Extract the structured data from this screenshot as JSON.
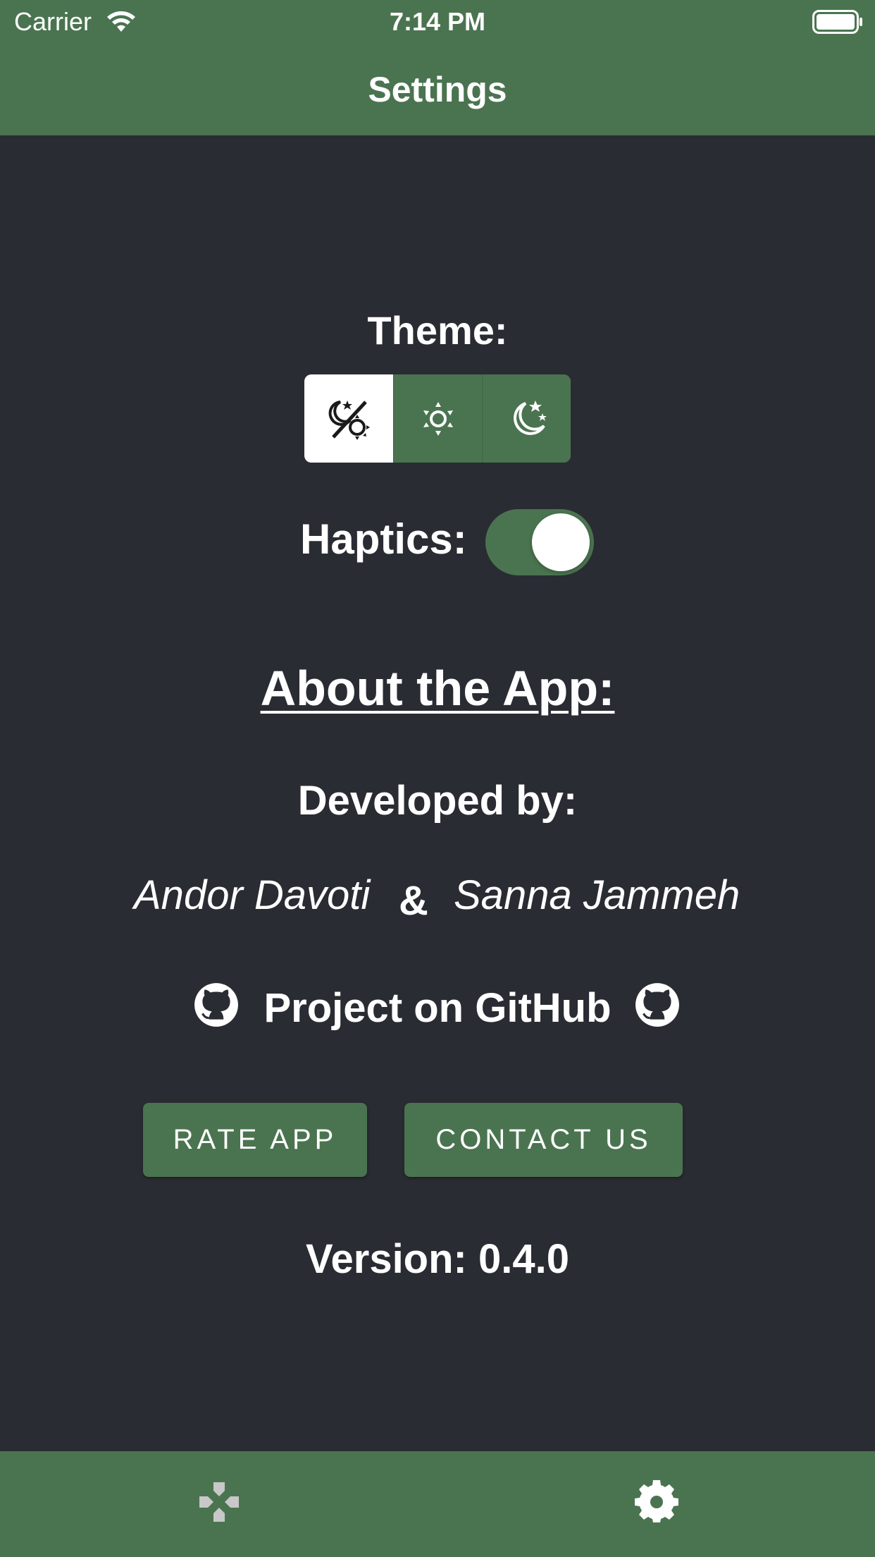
{
  "status_bar": {
    "carrier": "Carrier",
    "time": "7:14 PM"
  },
  "header": {
    "title": "Settings"
  },
  "theme": {
    "label": "Theme:",
    "options": [
      {
        "icon": "auto-theme-icon",
        "selected": true
      },
      {
        "icon": "light-theme-sun-icon",
        "selected": false
      },
      {
        "icon": "dark-theme-moon-icon",
        "selected": false
      }
    ]
  },
  "haptics": {
    "label": "Haptics:",
    "enabled": true
  },
  "about": {
    "title": "About the App:",
    "developed_by_label": "Developed by:",
    "developer_1": "Andor Davoti",
    "ampersand": "&",
    "developer_2": "Sanna Jammeh",
    "github_link": "Project on GitHub"
  },
  "buttons": {
    "rate_label": "RATE APP",
    "contact_label": "CONTACT US"
  },
  "version": "Version: 0.4.0",
  "tab_bar": {
    "tabs": [
      {
        "icon": "gamepad-icon",
        "active": false
      },
      {
        "icon": "gear-icon",
        "active": true
      }
    ]
  },
  "colors": {
    "accent": "#4a7450",
    "background": "#2a2c33",
    "text": "#ffffff",
    "inactive_icon": "#c8c8c8"
  }
}
